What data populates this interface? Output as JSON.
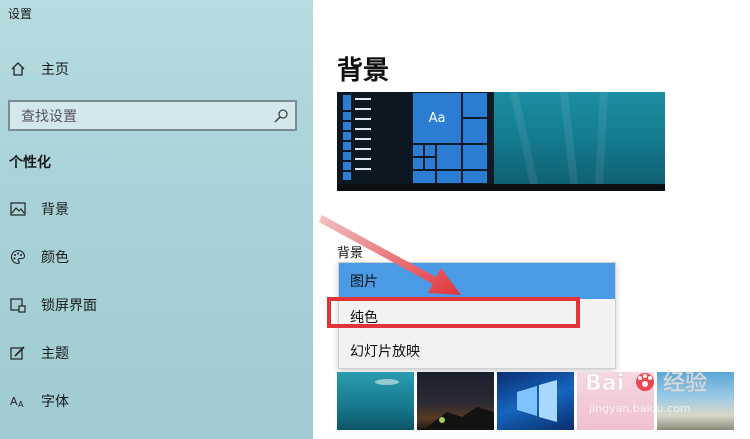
{
  "window": {
    "title": "设置"
  },
  "sidebar": {
    "home_label": "主页",
    "search_placeholder": "查找设置",
    "section_title": "个性化",
    "items": [
      {
        "label": "背景",
        "icon": "image-icon"
      },
      {
        "label": "颜色",
        "icon": "palette-icon"
      },
      {
        "label": "锁屏界面",
        "icon": "lock-screen-icon"
      },
      {
        "label": "主题",
        "icon": "theme-icon"
      },
      {
        "label": "字体",
        "icon": "font-icon"
      }
    ]
  },
  "main": {
    "page_title": "背景",
    "preview_tile_text": "Aa",
    "background_label": "背景",
    "dropdown_options": [
      "图片",
      "纯色",
      "幻灯片放映"
    ],
    "selected_option": "图片",
    "highlighted_option": "纯色"
  },
  "watermark": {
    "brand": "Bai",
    "brand_cn": "经验",
    "url": "jingyan.baidu.com"
  },
  "colors": {
    "accent": "#4a9ae6",
    "highlight": "#e2333a",
    "tile": "#2b7cd3"
  }
}
